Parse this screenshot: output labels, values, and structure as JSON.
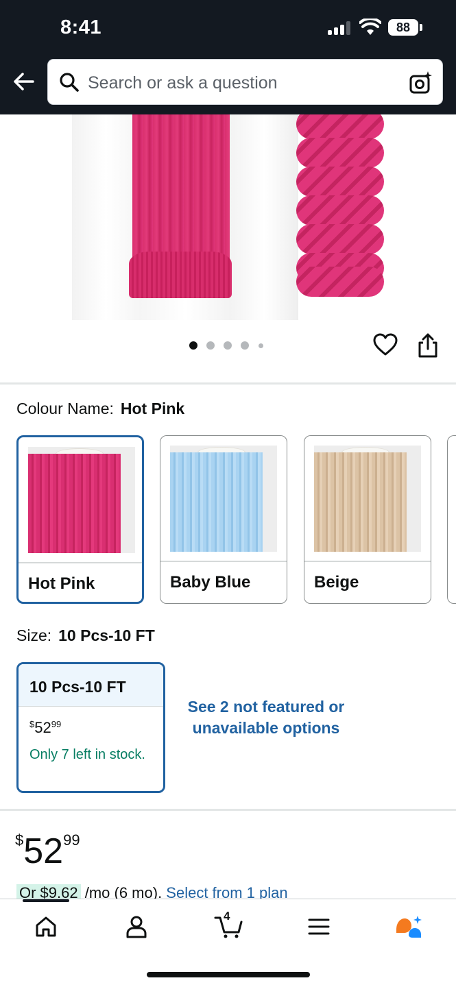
{
  "status_bar": {
    "time": "8:41",
    "battery": "88"
  },
  "search": {
    "placeholder": "Search or ask a question"
  },
  "product": {
    "image_count": 5,
    "active_image": 1
  },
  "colour": {
    "label": "Colour Name:",
    "selected": "Hot Pink",
    "options": [
      {
        "name": "Hot Pink",
        "color": "#d92f71",
        "selected": true
      },
      {
        "name": "Baby Blue",
        "color": "#a9d3f1",
        "selected": false
      },
      {
        "name": "Beige",
        "color": "#dcc3a5",
        "selected": false
      }
    ]
  },
  "size": {
    "label": "Size:",
    "selected": "10 Pcs-10 FT",
    "card": {
      "title": "10 Pcs-10 FT",
      "price_currency": "$",
      "price_whole": "52",
      "price_cents": "99",
      "stock": "Only 7 left in stock."
    },
    "see_more": "See 2 not featured or unavailable options"
  },
  "price": {
    "currency": "$",
    "whole": "52",
    "cents": "99",
    "installment_prefix": "Or $9.62",
    "installment_suffix": " /mo (6 mo). ",
    "installment_link": "Select from 1 plan"
  },
  "nav": {
    "cart_count": "4",
    "items": [
      "home-icon",
      "account-icon",
      "cart-icon",
      "menu-icon",
      "rufus-icon"
    ]
  },
  "colors": {
    "header_bg": "#131921",
    "accent_blue": "#2162a1",
    "stock_green": "#067d62"
  }
}
